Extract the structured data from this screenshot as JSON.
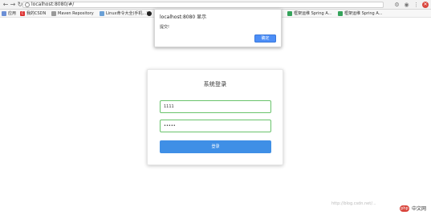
{
  "browser": {
    "url": "localhost:8080/#/",
    "nav": {
      "back_label": "←",
      "forward_label": "→",
      "reload_label": "↻"
    },
    "icons": [
      "info-icon",
      "extensions-icon",
      "profile-icon",
      "menu-icon",
      "close-icon"
    ],
    "bookmarks": [
      {
        "label": "应用",
        "icon": "apps-icon"
      },
      {
        "label": "我的CSDN",
        "icon": "csdn-icon"
      },
      {
        "label": "Maven Repository",
        "icon": "maven-icon"
      },
      {
        "label": "Linux命令大全(手机...)",
        "icon": "linux-icon"
      },
      {
        "label": "",
        "icon": "github-icon"
      },
      {
        "label": "框架运维 Spring A...",
        "icon": "bookmark-icon"
      },
      {
        "label": "框架运维 Spring A...",
        "icon": "bookmark-icon"
      }
    ]
  },
  "alert": {
    "title": "localhost:8080 显示",
    "message": "提交!",
    "ok_label": "确定"
  },
  "login": {
    "title": "系统登录",
    "username_value": "1111",
    "password_value": "•••••",
    "submit_label": "登录"
  },
  "watermark": {
    "text": "http://blog.csdn.net/...",
    "badge_text": "中文网",
    "badge_logo": "php"
  },
  "colors": {
    "alert_button": "#4c8ef7",
    "field_border": "#69c36b",
    "login_button": "#3f8fe6"
  }
}
